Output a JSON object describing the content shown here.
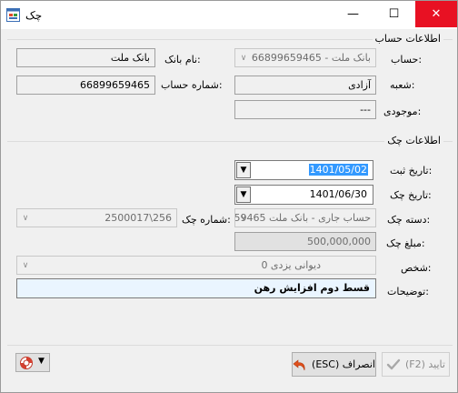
{
  "window": {
    "title": "چک",
    "minimize": "—",
    "maximize": "☐",
    "close": "✕"
  },
  "account_group": {
    "title": "اطلاعات حساب",
    "account_label": "حساب:",
    "account_value": "بانک ملت - 66899659465",
    "bank_name_label": "نام بانک:",
    "bank_name_value": "بانک ملت",
    "branch_label": "شعبه:",
    "branch_value": "آزادی",
    "account_number_label": "شماره حساب:",
    "account_number_value": "66899659465",
    "balance_label": "موجودی:",
    "balance_value": "---"
  },
  "check_group": {
    "title": "اطلاعات چک",
    "register_date_label": "تاریخ ثبت:",
    "register_date_value": "1401/05/02",
    "check_date_label": "تاریخ چک:",
    "check_date_value": "1401/06/30",
    "checkbook_label": "دسته چک:",
    "checkbook_value": "حساب جاری - بانک ملت 659465ة",
    "check_number_label": "شماره چک:",
    "check_number_value": "2500017\\256",
    "amount_label": "مبلغ چک:",
    "amount_value": "500,000,000",
    "person_label": "شخص:",
    "person_value": "دیوانی یزدی 0",
    "description_label": "توضیحات:",
    "description_value": "قسط دوم افزایش رهن"
  },
  "buttons": {
    "confirm": "(F2) تایید",
    "cancel": "(ESC) انصراف"
  }
}
